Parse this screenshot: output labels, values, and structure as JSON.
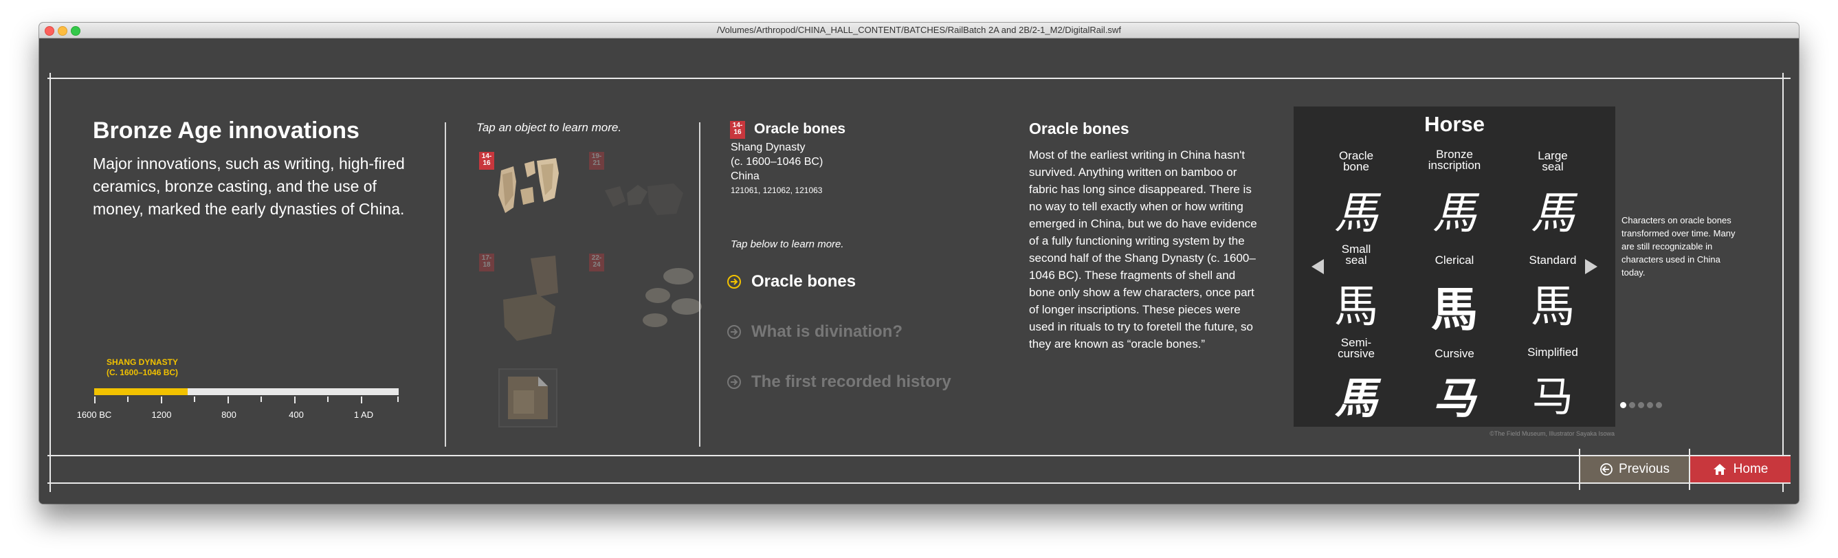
{
  "window": {
    "title": "/Volumes/Arthropod/CHINA_HALL_CONTENT/BATCHES/RailBatch 2A and 2B/2-1_M2/DigitalRail.swf"
  },
  "intro": {
    "heading": "Bronze Age innovations",
    "body": "Major innovations, such as writing, high-fired ceramics, bronze casting, and the use of money, marked the early dynasties of China."
  },
  "timeline": {
    "label_line1": "SHANG DYNASTY",
    "label_line2": "(C. 1600–1046 BC)",
    "ticks": [
      "1600 BC",
      "1200",
      "800",
      "400",
      "1 AD"
    ],
    "highlight_fraction": 0.307,
    "highlight_color": "#f2c200"
  },
  "objects": {
    "instruction": "Tap an object to learn more.",
    "badges": [
      {
        "line1": "14-",
        "line2": "16"
      },
      {
        "line1": "19-",
        "line2": "21"
      },
      {
        "line1": "17-",
        "line2": "18"
      },
      {
        "line1": "22-",
        "line2": "24"
      }
    ]
  },
  "detail": {
    "badge_line1": "14-",
    "badge_line2": "16",
    "title": "Oracle bones",
    "line1": "Shang Dynasty",
    "line2": "(c. 1600–1046 BC)",
    "line3": "China",
    "catalog": "121061, 121062, 121063",
    "instruction": "Tap below to learn more.",
    "topics": [
      {
        "label": "Oracle bones",
        "active": true
      },
      {
        "label": "What is divination?",
        "active": false
      },
      {
        "label": "The first recorded history",
        "active": false
      }
    ]
  },
  "article": {
    "title": "Oracle bones",
    "body": "Most of the earliest writing in China hasn't survived. Anything written on bamboo or fabric has long since disappeared. There is no way to tell exactly when or how writing emerged in China, but we do have evidence of a fully functioning writing system by the second half of the Shang Dynasty (c. 1600–1046 BC). These fragments of shell and bone only show a few characters, once part of longer inscriptions. These pieces were used in rituals to try to foretell the future, so they are known as “oracle bones.”"
  },
  "horse_panel": {
    "title": "Horse",
    "cells": [
      {
        "label1": "Oracle",
        "label2": "bone",
        "char": "馬"
      },
      {
        "label1": "Bronze",
        "label2": "inscription",
        "char": "馬"
      },
      {
        "label1": "Large",
        "label2": "seal",
        "char": "馬"
      },
      {
        "label1": "Small",
        "label2": "seal",
        "char": "馬"
      },
      {
        "label1": "Clerical",
        "label2": "",
        "char": "馬"
      },
      {
        "label1": "Standard",
        "label2": "",
        "char": "馬"
      },
      {
        "label1": "Semi-",
        "label2": "cursive",
        "char": "馬"
      },
      {
        "label1": "Cursive",
        "label2": "",
        "char": "马"
      },
      {
        "label1": "Simplified",
        "label2": "",
        "char": "马"
      }
    ],
    "caption": "Characters on oracle bones transformed over time. Many are still recognizable in characters used in China today.",
    "credit": "©The Field Museum, Illustrator Sayaka Isowa",
    "page_index": 1,
    "page_count": 5
  },
  "nav": {
    "previous": "Previous",
    "home": "Home"
  },
  "colors": {
    "accent": "#c8373d",
    "yellow": "#f2c200",
    "background": "#424242",
    "muted": "#777777"
  }
}
